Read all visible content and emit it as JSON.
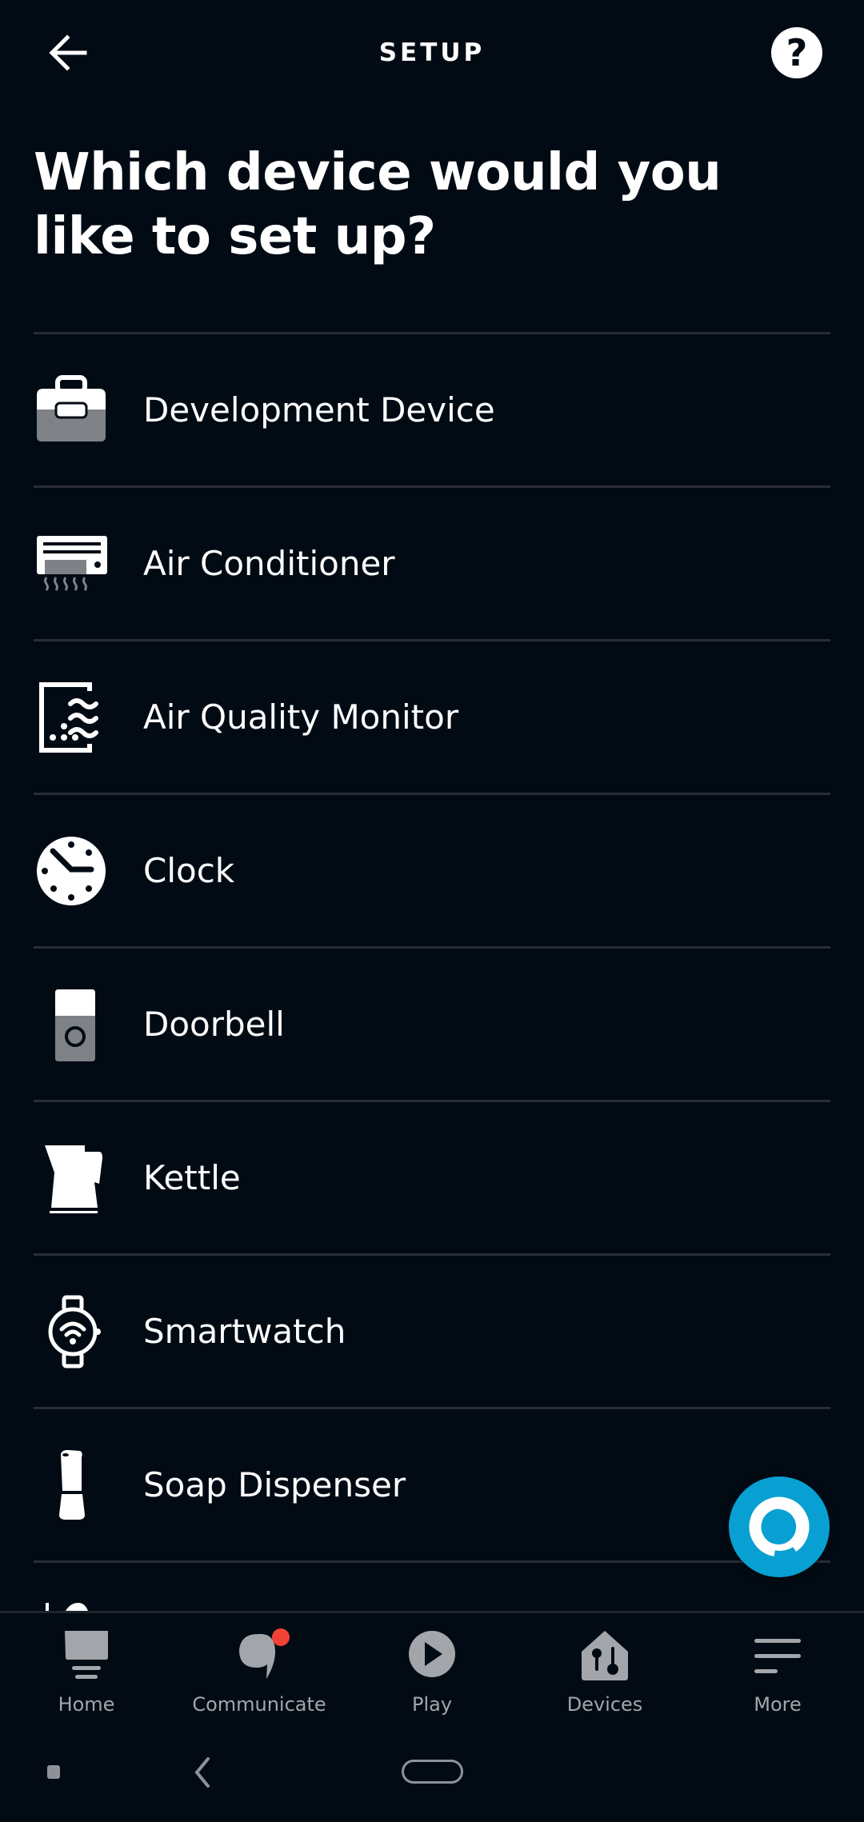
{
  "header": {
    "title": "SETUP",
    "back_icon": "arrow-left-icon",
    "help_icon": "question-circle-icon",
    "help_glyph": "?"
  },
  "page": {
    "heading": "Which device would you like to set up?"
  },
  "device_list": {
    "items": [
      {
        "label": "",
        "icon": "partial-device-icon"
      },
      {
        "label": "Development Device",
        "icon": "toolbox-icon"
      },
      {
        "label": "Air Conditioner",
        "icon": "air-conditioner-icon"
      },
      {
        "label": "Air Quality Monitor",
        "icon": "air-quality-monitor-icon"
      },
      {
        "label": "Clock",
        "icon": "clock-icon"
      },
      {
        "label": "Doorbell",
        "icon": "doorbell-icon"
      },
      {
        "label": "Kettle",
        "icon": "kettle-icon"
      },
      {
        "label": "Smartwatch",
        "icon": "smartwatch-icon"
      },
      {
        "label": "Soap Dispenser",
        "icon": "soap-dispenser-icon"
      },
      {
        "label": "",
        "icon": "partial-device-icon"
      }
    ]
  },
  "alexa_button": {
    "icon": "alexa-icon",
    "color": "#08a0d2"
  },
  "bottom_nav": {
    "items": [
      {
        "label": "Home",
        "icon": "home-icon"
      },
      {
        "label": "Communicate",
        "icon": "communicate-icon",
        "has_notification": true
      },
      {
        "label": "Play",
        "icon": "play-icon"
      },
      {
        "label": "Devices",
        "icon": "devices-icon"
      },
      {
        "label": "More",
        "icon": "more-icon"
      }
    ]
  },
  "colors": {
    "background": "#020b14",
    "accent": "#08a0d2",
    "notification": "#f24236",
    "nav_inactive": "#a2a6aa",
    "divider": "#2a2e33"
  }
}
